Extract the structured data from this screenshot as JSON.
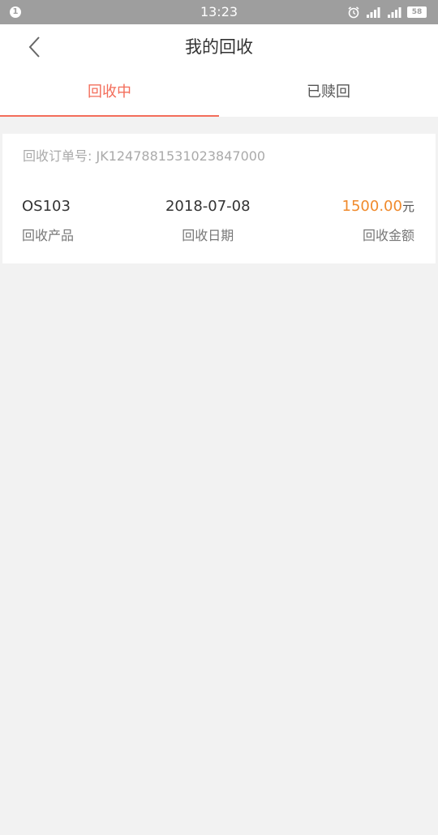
{
  "status_bar": {
    "time": "13:23",
    "notification_badge": "1",
    "battery": "58",
    "color": "#9e9e9e"
  },
  "nav": {
    "title": "我的回收"
  },
  "tabs": [
    {
      "label": "回收中",
      "active": true
    },
    {
      "label": "已赎回",
      "active": false
    }
  ],
  "record": {
    "order_label": "回收订单号: ",
    "order_no": "JK1247881531023847000",
    "product_value": "OS103",
    "product_label": "回收产品",
    "date_value": "2018-07-08",
    "date_label": "回收日期",
    "amount_value": "1500.00",
    "amount_unit": "元",
    "amount_label": "回收金额"
  },
  "colors": {
    "accent": "#f36d5a",
    "amount": "#f08a2c",
    "background": "#f2f2f2"
  }
}
